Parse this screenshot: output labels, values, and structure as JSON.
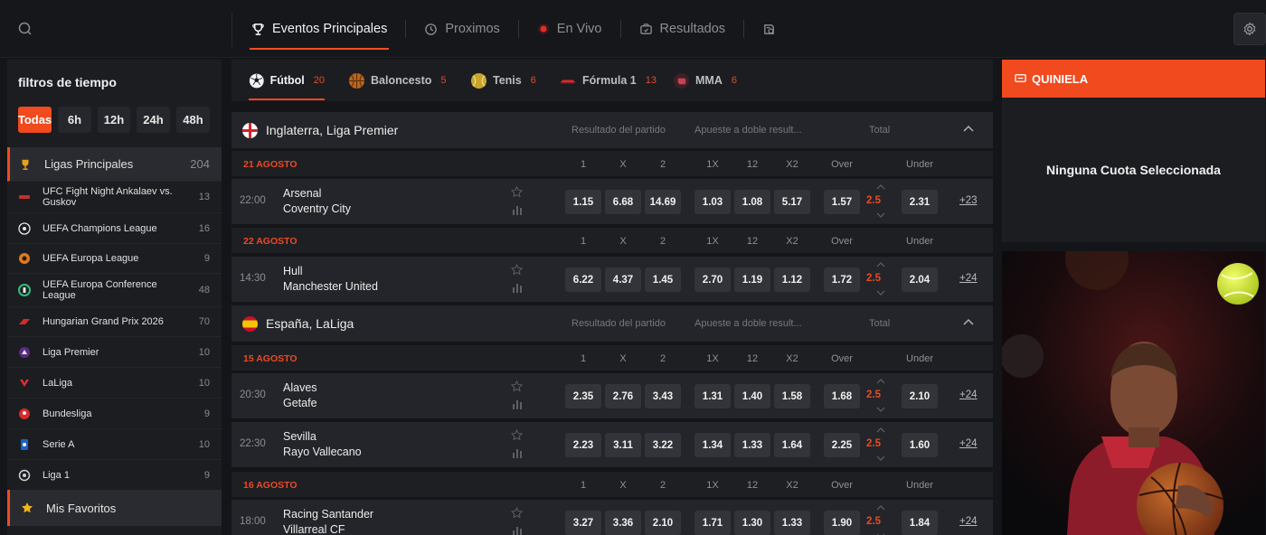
{
  "nav": {
    "tabs": [
      {
        "label": "Eventos Principales",
        "icon": "trophy-icon",
        "active": true
      },
      {
        "label": "Proximos",
        "icon": "clock-icon",
        "active": false
      },
      {
        "label": "En Vivo",
        "icon": "live-dot-icon",
        "active": false
      },
      {
        "label": "Resultados",
        "icon": "results-icon",
        "active": false
      },
      {
        "label": "",
        "icon": "betslip-icon",
        "active": false
      }
    ]
  },
  "sidebar": {
    "title": "filtros de tiempo",
    "time_filters": [
      "Todas",
      "6h",
      "12h",
      "24h",
      "48h"
    ],
    "active_filter": "Todas",
    "main_leagues": {
      "label": "Ligas Principales",
      "count": "204"
    },
    "leagues": [
      {
        "name": "UFC Fight Night Ankalaev vs. Guskov",
        "count": "13",
        "icon": "ufc-icon"
      },
      {
        "name": "UEFA Champions League",
        "count": "16",
        "icon": "champions-league-icon"
      },
      {
        "name": "UEFA Europa League",
        "count": "9",
        "icon": "europa-league-icon"
      },
      {
        "name": "UEFA Europa Conference League",
        "count": "48",
        "icon": "conference-league-icon"
      },
      {
        "name": "Hungarian Grand Prix 2026",
        "count": "70",
        "icon": "f1-icon"
      },
      {
        "name": "Liga Premier",
        "count": "10",
        "icon": "premier-league-icon"
      },
      {
        "name": "LaLiga",
        "count": "10",
        "icon": "laliga-icon"
      },
      {
        "name": "Bundesliga",
        "count": "9",
        "icon": "bundesliga-icon"
      },
      {
        "name": "Serie A",
        "count": "10",
        "icon": "serie-a-icon"
      },
      {
        "name": "Liga 1",
        "count": "9",
        "icon": "ligue-1-icon"
      }
    ],
    "favorites": "Mis Favoritos"
  },
  "sports": [
    {
      "name": "Fútbol",
      "count": "20",
      "icon": "football-icon",
      "active": true
    },
    {
      "name": "Baloncesto",
      "count": "5",
      "icon": "basketball-icon"
    },
    {
      "name": "Tenis",
      "count": "6",
      "icon": "tennis-icon"
    },
    {
      "name": "Fórmula 1",
      "count": "13",
      "icon": "formula1-icon"
    },
    {
      "name": "MMA",
      "count": "6",
      "icon": "mma-icon"
    }
  ],
  "market_headers": {
    "result": "Resultado del partido",
    "double": "Apueste a doble result...",
    "total": "Total"
  },
  "market_labels": [
    "1",
    "X",
    "2",
    "1X",
    "12",
    "X2",
    "Over",
    "Under"
  ],
  "groups": [
    {
      "league": "Inglaterra, Liga Premier",
      "flag": "england-flag",
      "dates": [
        {
          "date": "21 AGOSTO",
          "matches": [
            {
              "time": "22:00",
              "home": "Arsenal",
              "away": "Coventry City",
              "odds": [
                "1.15",
                "6.68",
                "14.69",
                "1.03",
                "1.08",
                "5.17",
                "1.57",
                "2.31"
              ],
              "line": "2.5",
              "more": "+23"
            }
          ]
        },
        {
          "date": "22 AGOSTO",
          "matches": [
            {
              "time": "14:30",
              "home": "Hull",
              "away": "Manchester United",
              "odds": [
                "6.22",
                "4.37",
                "1.45",
                "2.70",
                "1.19",
                "1.12",
                "1.72",
                "2.04"
              ],
              "line": "2.5",
              "more": "+24"
            }
          ]
        }
      ]
    },
    {
      "league": "España, LaLiga",
      "flag": "spain-flag",
      "dates": [
        {
          "date": "15 AGOSTO",
          "matches": [
            {
              "time": "20:30",
              "home": "Alaves",
              "away": "Getafe",
              "odds": [
                "2.35",
                "2.76",
                "3.43",
                "1.31",
                "1.40",
                "1.58",
                "1.68",
                "2.10"
              ],
              "line": "2.5",
              "more": "+24"
            },
            {
              "time": "22:30",
              "home": "Sevilla",
              "away": "Rayo Vallecano",
              "odds": [
                "2.23",
                "3.11",
                "3.22",
                "1.34",
                "1.33",
                "1.64",
                "2.25",
                "1.60"
              ],
              "line": "2.5",
              "more": "+24"
            }
          ]
        },
        {
          "date": "16 AGOSTO",
          "matches": [
            {
              "time": "18:00",
              "home": "Racing Santander",
              "away": "Villarreal CF",
              "odds": [
                "3.27",
                "3.36",
                "2.10",
                "1.71",
                "1.30",
                "1.33",
                "1.90",
                "1.84"
              ],
              "line": "2.5",
              "more": "+24"
            }
          ]
        }
      ]
    }
  ],
  "quiniela": {
    "title": "QUINIELA",
    "empty": "Ninguna Cuota Seleccionada"
  },
  "colors": {
    "accent": "#f04a1e",
    "background": "#141518",
    "panel": "#1c1d21",
    "odd_button": "#33343a"
  }
}
